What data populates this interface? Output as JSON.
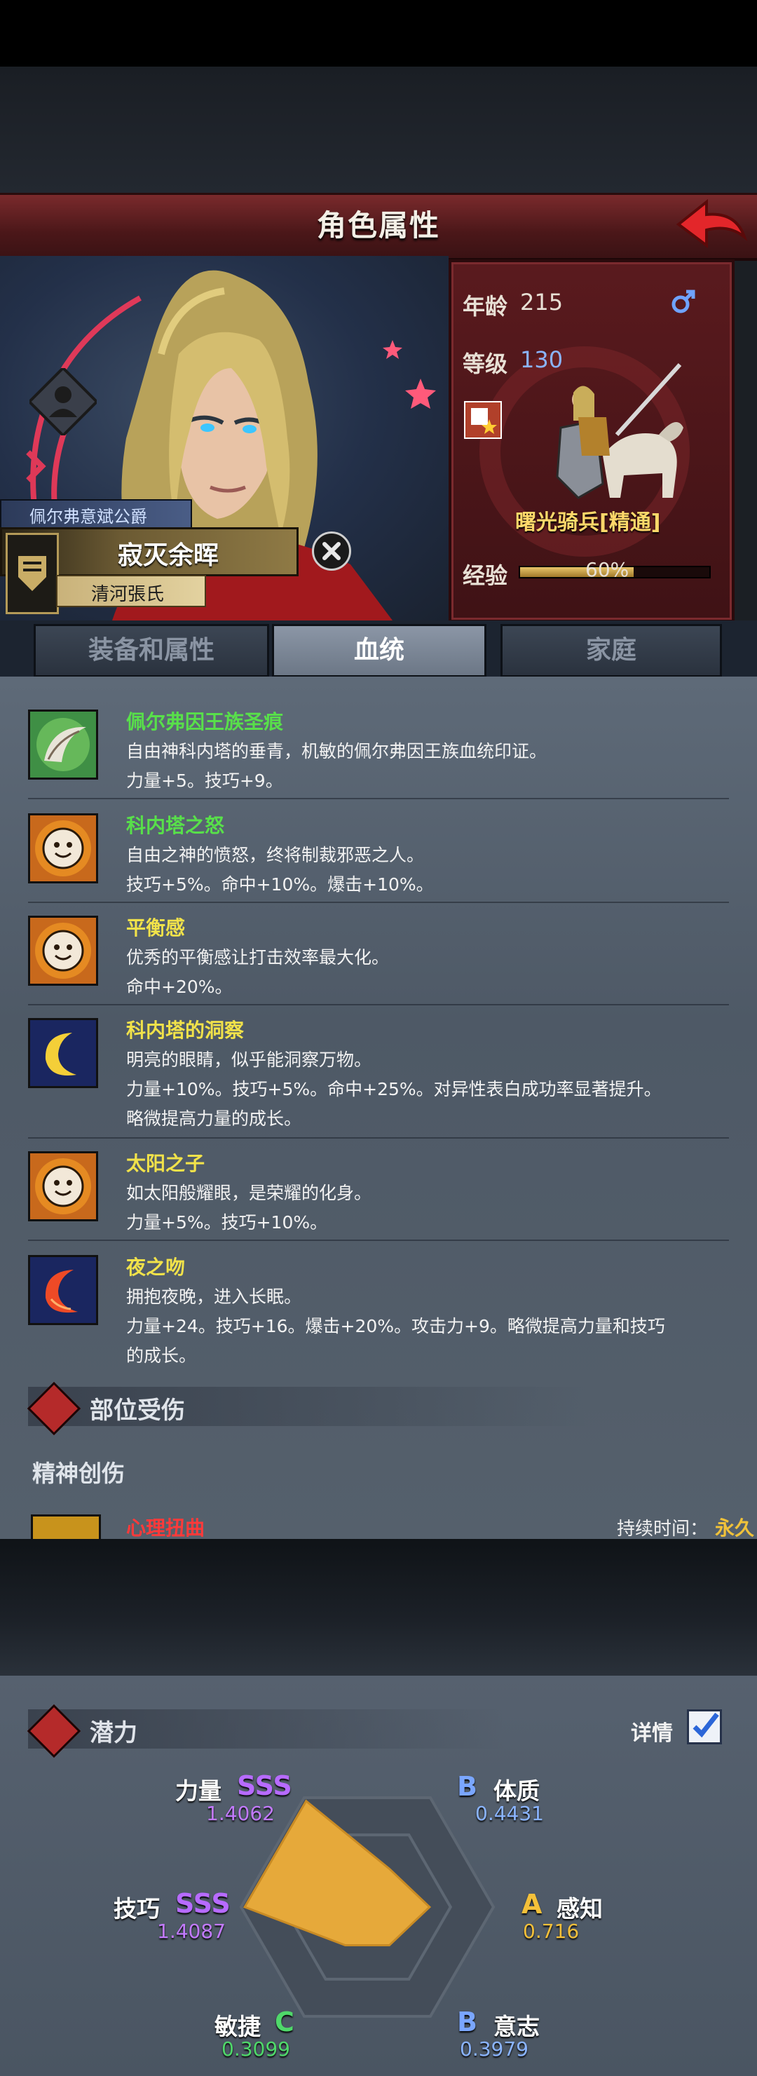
{
  "header": {
    "title": "角色属性",
    "back_icon": "back-arrow-icon"
  },
  "character": {
    "title_rank": "佩尔弗意斌公爵",
    "name": "寂灭余晖",
    "family": "清河張氏"
  },
  "info": {
    "age_label": "年龄",
    "age_value": "215",
    "gender_icon": "male-icon",
    "level_label": "等级",
    "level_value": "130",
    "unit_name": "曙光骑兵[精通]",
    "exp_label": "经验",
    "exp_value": "60%",
    "exp_fraction": 0.6
  },
  "tabs": [
    {
      "label": "装备和属性",
      "active": false
    },
    {
      "label": "血统",
      "active": true
    },
    {
      "label": "家庭",
      "active": false
    }
  ],
  "bloodlines": [
    {
      "name": "佩尔弗因王族圣痕",
      "color": "green",
      "icon": "feather-icon",
      "lines": [
        "自由神科内塔的垂青，机敏的佩尔弗因王族血统印证。",
        "力量+5。技巧+9。"
      ]
    },
    {
      "name": "科内塔之怒",
      "color": "green",
      "icon": "sun-face-icon",
      "lines": [
        "自由之神的愤怒，终将制裁邪恶之人。",
        "技巧+5%。命中+10%。爆击+10%。"
      ]
    },
    {
      "name": "平衡感",
      "color": "yellow",
      "icon": "sun-face-icon",
      "lines": [
        "优秀的平衡感让打击效率最大化。",
        "命中+20%。"
      ]
    },
    {
      "name": "科内塔的洞察",
      "color": "yellow",
      "icon": "crescent-moon-icon",
      "lines": [
        "明亮的眼睛，似乎能洞察万物。",
        "力量+10%。技巧+5%。命中+25%。对异性表白成功率显著提升。",
        "略微提高力量的成长。"
      ]
    },
    {
      "name": "太阳之子",
      "color": "yellow",
      "icon": "sun-face-icon",
      "lines": [
        "如太阳般耀眼，是荣耀的化身。",
        "力量+5%。技巧+10%。"
      ]
    },
    {
      "name": "夜之吻",
      "color": "yellow",
      "icon": "red-moon-icon",
      "lines": [
        "拥抱夜晚，进入长眠。",
        "力量+24。技巧+16。爆击+20%。攻击力+9。略微提高力量和技巧",
        "的成长。"
      ]
    }
  ],
  "injury": {
    "section_title": "部位受伤",
    "sub_title": "精神创伤",
    "item_name": "心理扭曲",
    "duration_label": "持续时间：",
    "duration_value": "永久"
  },
  "potential": {
    "section_title": "潜力",
    "detail_label": "详情",
    "detail_checked": true,
    "stats": [
      {
        "label": "力量",
        "grade": "SSS",
        "value": "1.4062"
      },
      {
        "label": "体质",
        "grade": "B",
        "value": "0.4431"
      },
      {
        "label": "感知",
        "grade": "A",
        "value": "0.716"
      },
      {
        "label": "意志",
        "grade": "B",
        "value": "0.3979"
      },
      {
        "label": "敏捷",
        "grade": "C",
        "value": "0.3099"
      },
      {
        "label": "技巧",
        "grade": "SSS",
        "value": "1.4087"
      }
    ]
  },
  "colors": {
    "accent_red": "#7a2a2c",
    "green_text": "#58e04a",
    "yellow_text": "#f1e24a",
    "radar_fill": "#e6a93a"
  }
}
